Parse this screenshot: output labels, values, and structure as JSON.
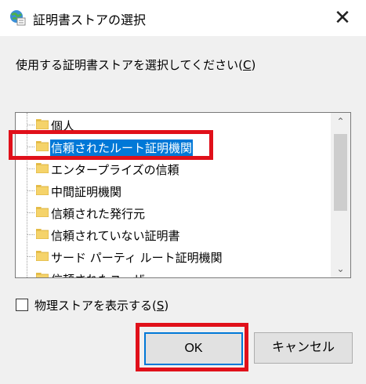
{
  "window": {
    "title": "証明書ストアの選択",
    "close_glyph": "✕"
  },
  "prompt": {
    "text": "使用する証明書ストアを選択してください(",
    "accel": "C",
    "suffix": ")"
  },
  "tree": {
    "items": [
      {
        "label": "個人",
        "selected": false
      },
      {
        "label": "信頼されたルート証明機関",
        "selected": true
      },
      {
        "label": "エンタープライズの信頼",
        "selected": false
      },
      {
        "label": "中間証明機関",
        "selected": false
      },
      {
        "label": "信頼された発行元",
        "selected": false
      },
      {
        "label": "信頼されていない証明書",
        "selected": false
      },
      {
        "label": "サード パーティ ルート証明機関",
        "selected": false
      },
      {
        "label": "信頼されたユーザ",
        "selected": false
      }
    ],
    "scroll_up": "⌃",
    "scroll_down": "⌄"
  },
  "physical_store": {
    "label": "物理ストアを表示する(",
    "accel": "S",
    "suffix": ")",
    "checked": false
  },
  "buttons": {
    "ok": "OK",
    "cancel": "キャンセル"
  },
  "colors": {
    "selection": "#0078d7",
    "annotation": "#e0101a"
  }
}
